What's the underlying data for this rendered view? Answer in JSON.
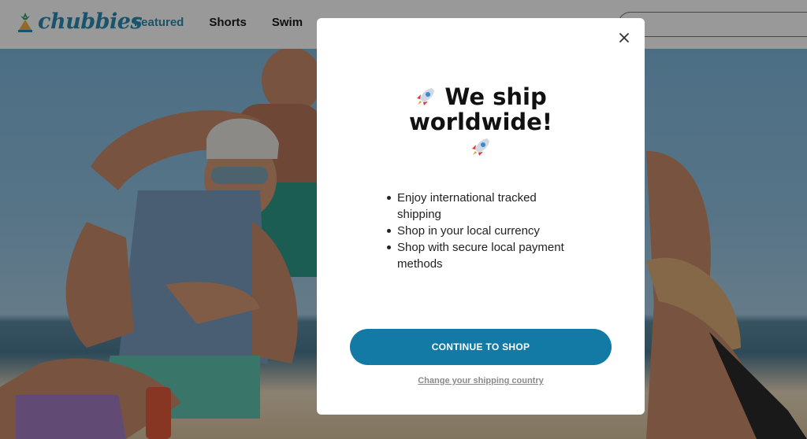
{
  "brand": {
    "name": "chubbies",
    "color": "#2a8ab4"
  },
  "nav": {
    "items": [
      {
        "label": "Featured",
        "active": true
      },
      {
        "label": "Shorts",
        "active": false
      },
      {
        "label": "Swim",
        "active": false
      }
    ]
  },
  "search": {
    "placeholder": ""
  },
  "modal": {
    "title": "We ship worldwide!",
    "title_icon": "rocket-icon",
    "bullets": [
      "Enjoy international tracked shipping",
      "Shop in your local currency",
      "Shop with secure local payment methods"
    ],
    "cta_label": "CONTINUE TO SHOP",
    "cta_color": "#137aa6",
    "change_country_link": "Change your shipping country",
    "close_icon": "close-icon"
  }
}
